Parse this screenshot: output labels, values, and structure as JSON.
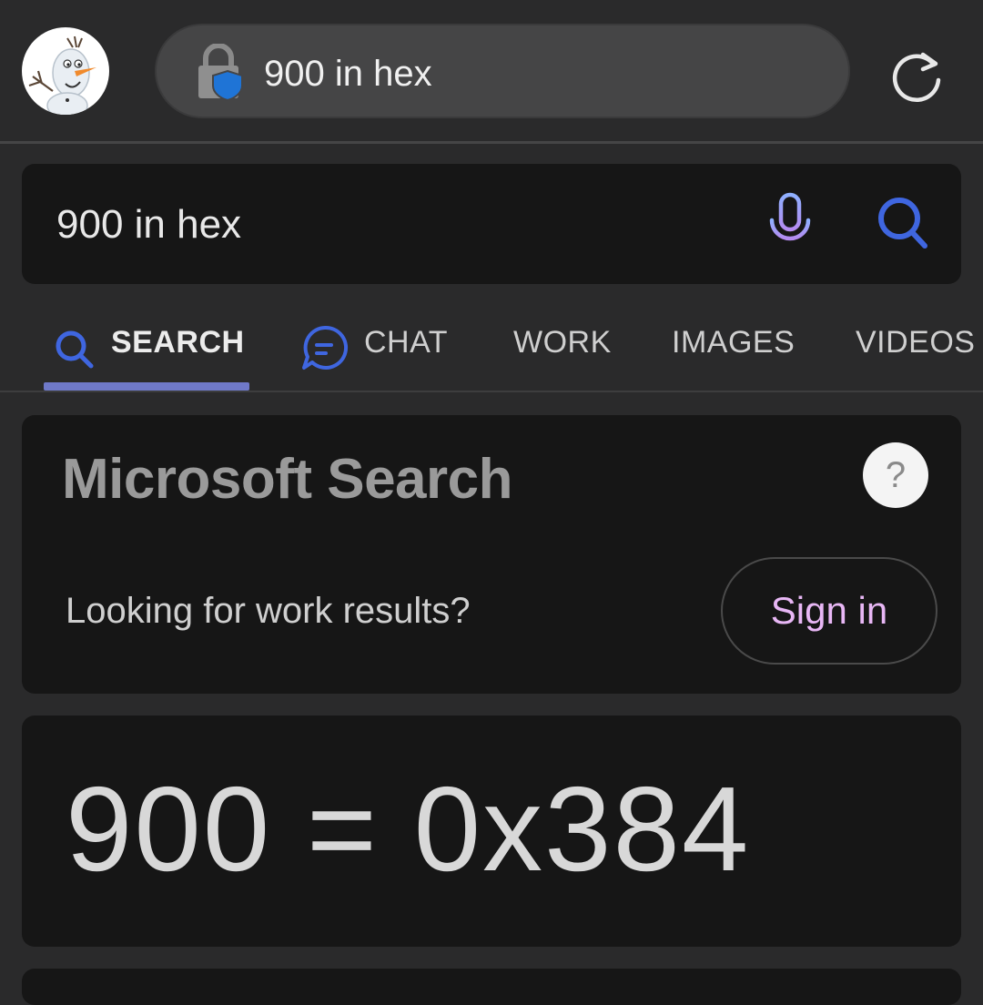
{
  "browser": {
    "address_text": "900 in hex",
    "avatar_icon": "olaf-avatar-icon",
    "lock_icon": "lock-shield-icon",
    "refresh_icon": "refresh-icon"
  },
  "search": {
    "query": "900 in hex",
    "mic_icon": "microphone-icon",
    "search_icon": "search-icon"
  },
  "tabs": [
    {
      "label": "SEARCH",
      "icon": "search-icon",
      "active": true
    },
    {
      "label": "CHAT",
      "icon": "chat-icon",
      "active": false
    },
    {
      "label": "WORK",
      "active": false
    },
    {
      "label": "IMAGES",
      "active": false
    },
    {
      "label": "VIDEOS",
      "active": false
    }
  ],
  "ms_card": {
    "brand": "Microsoft Search",
    "help": "?",
    "prompt": "Looking for work results?",
    "signin_label": "Sign in"
  },
  "result": {
    "text": "900 = 0x384"
  },
  "colors": {
    "accent": "#6f79c9",
    "search_icon_blue": "#3f66e0",
    "signin_text": "#e8b7f5",
    "background": "#2a2a2b",
    "card": "#161616"
  }
}
